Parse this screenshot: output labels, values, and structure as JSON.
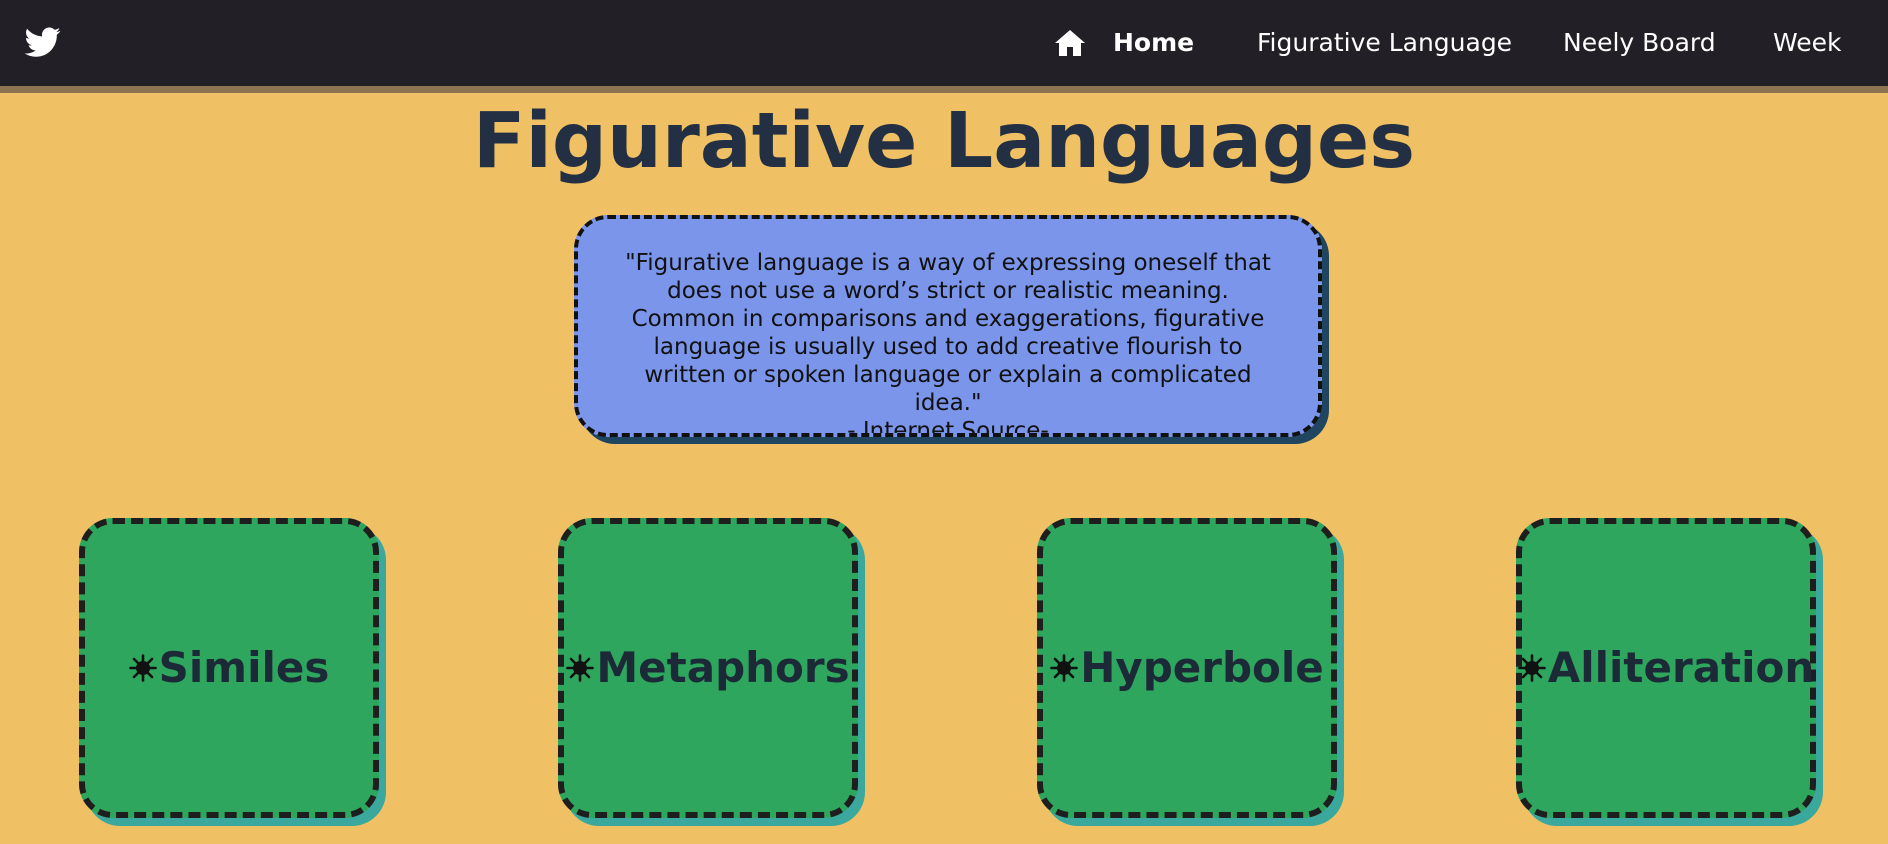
{
  "nav": {
    "logo_icon": "twitter-bird-icon",
    "home_icon": "home-icon",
    "links": [
      {
        "label": "Home"
      },
      {
        "label": "Figurative Language"
      },
      {
        "label": "Neely Board"
      },
      {
        "label": "Week"
      }
    ]
  },
  "page": {
    "title": "Figurative Languages"
  },
  "quote": {
    "text": "\"Figurative language is a way of expressing oneself that does not use a word’s strict or realistic meaning. Common in comparisons and exaggerations, figurative language is usually used to add creative flourish to written or spoken language or explain a complicated idea.\"",
    "source": "- Internet Source-"
  },
  "cards": [
    {
      "label": "Similes",
      "icon": "sun-icon"
    },
    {
      "label": "Metaphors",
      "icon": "sun-icon"
    },
    {
      "label": "Hyperbole",
      "icon": "sun-icon"
    },
    {
      "label": "Alliteration",
      "icon": "sun-icon"
    }
  ],
  "colors": {
    "background": "#efc064",
    "navbar": "#222026",
    "title": "#233044",
    "quote_box": "#7a95ea",
    "card": "#2ea65e",
    "card_shadow": "#3aa89c"
  }
}
